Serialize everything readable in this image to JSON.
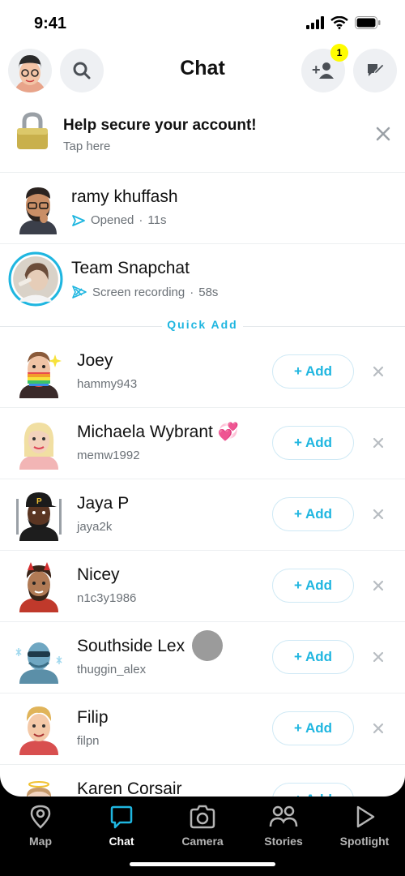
{
  "status_bar": {
    "time": "9:41"
  },
  "header": {
    "title": "Chat",
    "friend_requests_badge": "1"
  },
  "secure_banner": {
    "title": "Help secure your account!",
    "subtitle": "Tap here"
  },
  "chats": [
    {
      "name": "ramy khuffash",
      "status": "Opened",
      "time": "11s"
    },
    {
      "name": "Team Snapchat",
      "status": "Screen recording",
      "time": "58s"
    }
  ],
  "quick_add": {
    "label": "Quick Add",
    "add_label": "Add",
    "items": [
      {
        "name": "Joey",
        "username": "hammy943"
      },
      {
        "name": "Michaela Wybrant",
        "username": "memw1992",
        "emoji": "💞"
      },
      {
        "name": "Jaya P",
        "username": "jaya2k"
      },
      {
        "name": "Nicey",
        "username": "n1c3y1986"
      },
      {
        "name": "Southside Lex",
        "username": "thuggin_alex"
      },
      {
        "name": "Filip",
        "username": "filpn"
      },
      {
        "name": "Karen Corsair",
        "username": ""
      }
    ]
  },
  "nav": {
    "map": "Map",
    "chat": "Chat",
    "camera": "Camera",
    "stories": "Stories",
    "spotlight": "Spotlight"
  },
  "colors": {
    "accent": "#1fb6e0",
    "badge": "#fffc00",
    "nav_bg": "#000000"
  }
}
